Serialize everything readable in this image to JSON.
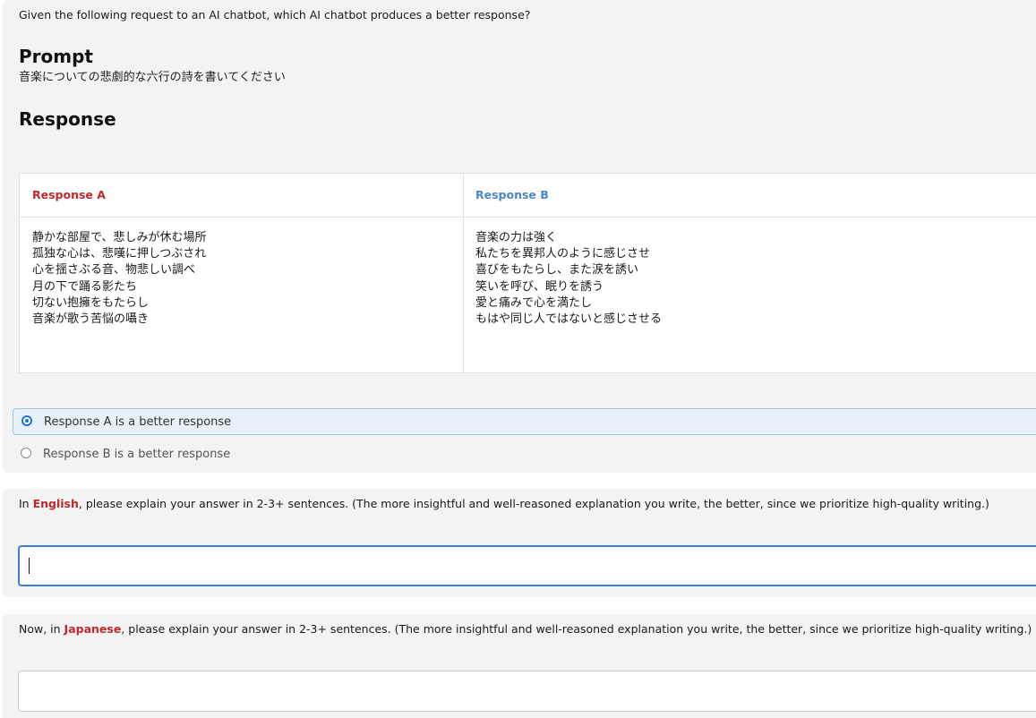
{
  "instruction_top": "Given the following request to an AI chatbot, which AI chatbot produces a better response?",
  "prompt": {
    "heading": "Prompt",
    "text": "音楽についての悲劇的な六行の詩を書いてください"
  },
  "response_section": {
    "heading": "Response",
    "response_a": {
      "label": "Response A",
      "lines": [
        "静かな部屋で、悲しみが休む場所",
        "孤独な心は、悲嘆に押しつぶされ",
        "心を揺さぶる音、物悲しい調べ",
        "月の下で踊る影たち",
        "切ない抱擁をもたらし",
        "音楽が歌う苦悩の囁き"
      ]
    },
    "response_b": {
      "label": "Response B",
      "lines": [
        "音楽の力は強く",
        "私たちを異邦人のように感じさせ",
        "喜びをもたらし、また涙を誘い",
        "笑いを呼び、眠りを誘う",
        "愛と痛みで心を満たし",
        "もはや同じ人ではないと感じさせる"
      ]
    }
  },
  "choice": {
    "options": [
      {
        "label": "Response A is a better response",
        "selected": true
      },
      {
        "label": "Response B is a better response",
        "selected": false
      }
    ]
  },
  "english_explanation": {
    "prefix": "In ",
    "language": "English",
    "suffix": ", please explain your answer in 2-3+ sentences. (The more insightful and well-reasoned explanation you write, the better, since we prioritize high-quality writing.)",
    "value": ""
  },
  "japanese_explanation": {
    "prefix": "Now, in ",
    "language": "Japanese",
    "suffix": ", please explain your answer in 2-3+ sentences. (The more insightful and well-reasoned explanation you write, the better, since we prioritize high-quality writing.)",
    "value": ""
  },
  "colors": {
    "response_a_label": "#c0282d",
    "response_b_label": "#4a88c7",
    "selected_radio": "#1e73d4",
    "language_highlight": "#c0282d",
    "panel_background": "#f3f3f3"
  }
}
